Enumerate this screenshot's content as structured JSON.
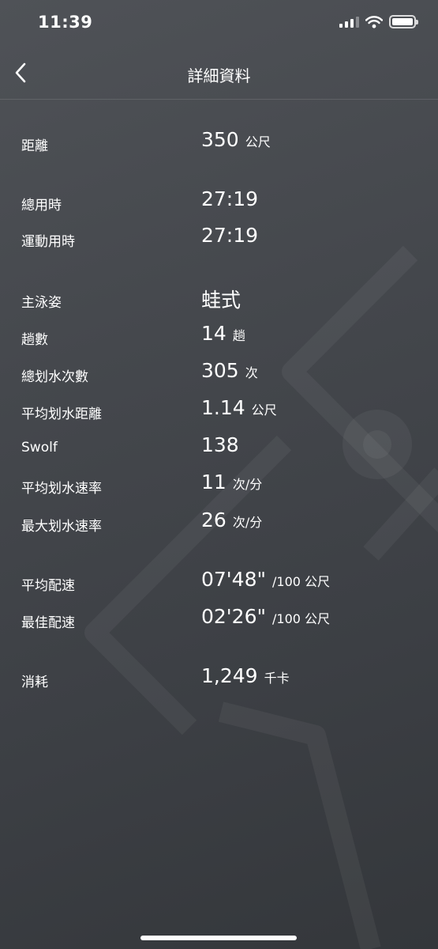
{
  "status_bar": {
    "time": "11:39"
  },
  "nav": {
    "title": "詳細資料"
  },
  "rows": [
    {
      "label": "距離",
      "value": "350",
      "unit": "公尺"
    },
    {
      "label": "總用時",
      "value": "27:19",
      "unit": ""
    },
    {
      "label": "運動用時",
      "value": "27:19",
      "unit": ""
    },
    {
      "label": "主泳姿",
      "value": "蛙式",
      "unit": ""
    },
    {
      "label": "趟數",
      "value": "14",
      "unit": "趟"
    },
    {
      "label": "總划水次數",
      "value": "305",
      "unit": "次"
    },
    {
      "label": "平均划水距離",
      "value": "1.14",
      "unit": "公尺"
    },
    {
      "label": "Swolf",
      "value": "138",
      "unit": ""
    },
    {
      "label": "平均划水速率",
      "value": "11",
      "unit": "次/分"
    },
    {
      "label": "最大划水速率",
      "value": "26",
      "unit": "次/分"
    },
    {
      "label": "平均配速",
      "value": "07'48\"",
      "unit": "/100 公尺"
    },
    {
      "label": "最佳配速",
      "value": "02'26\"",
      "unit": "/100 公尺"
    },
    {
      "label": "消耗",
      "value": "1,249",
      "unit": "千卡"
    }
  ],
  "icons": {
    "back": "chevron-left-icon",
    "signal": "signal-icon",
    "wifi": "wifi-icon",
    "battery": "battery-icon"
  }
}
